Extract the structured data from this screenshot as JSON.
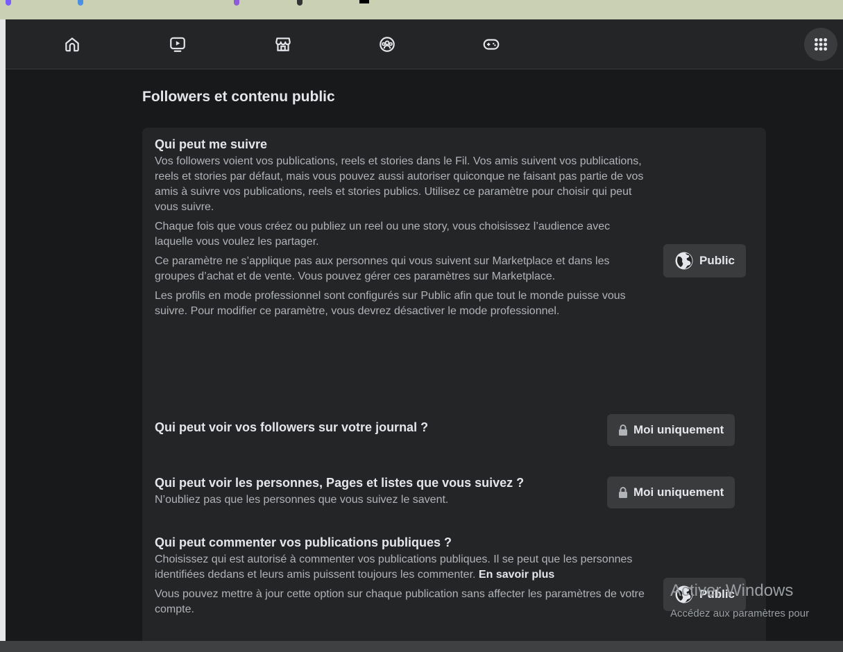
{
  "nav": {
    "tabs": [
      {
        "name": "home-icon"
      },
      {
        "name": "watch-icon"
      },
      {
        "name": "marketplace-icon"
      },
      {
        "name": "groups-icon"
      },
      {
        "name": "gaming-icon"
      }
    ],
    "menu_icon": "grid-menu-icon"
  },
  "page": {
    "title": "Followers et contenu public"
  },
  "sections": {
    "who_can_follow": {
      "title": "Qui peut me suivre",
      "p1": "Vos followers voient vos publications, reels et stories dans le Fil. Vos amis suivent vos publications, reels et stories par défaut, mais vous pouvez aussi autoriser quiconque ne faisant pas partie de vos amis à suivre vos publications, reels et stories publics. Utilisez ce paramètre pour choisir qui peut vous suivre.",
      "p2": "Chaque fois que vous créez ou publiez un reel ou une story, vous choisissez l’audience avec laquelle vous voulez les partager.",
      "p3": "Ce paramètre ne s’applique pas aux personnes qui vous suivent sur Marketplace et dans les groupes d’achat et de vente. Vous pouvez gérer ces paramètres sur Marketplace.",
      "p4": "Les profils en mode professionnel sont configurés sur Public afin que tout le monde puisse vous suivre. Pour modifier ce paramètre, vous devrez désactiver le mode professionnel.",
      "button": "Public"
    },
    "followers_visibility": {
      "title": "Qui peut voir vos followers sur votre journal ?",
      "button": "Moi uniquement"
    },
    "following_visibility": {
      "title": "Qui peut voir les personnes, Pages et listes que vous suivez ?",
      "desc": "N’oubliez pas que les personnes que vous suivez le savent.",
      "button": "Moi uniquement"
    },
    "public_comments": {
      "title": "Qui peut commenter vos publications publiques ?",
      "p1": "Choisissez qui est autorisé à commenter vos publications publiques. Il se peut que les personnes identifiées dedans et leurs amis puissent toujours les commenter.",
      "learn_more": "En savoir plus",
      "p2": "Vous pouvez mettre à jour cette option sur chaque publication sans affecter les paramètres de votre compte.",
      "button": "Public"
    }
  },
  "watermark": {
    "line1": "Activer Windows",
    "line2": "Accédez aux paramètres pour"
  },
  "colors": {
    "background": "#18191a",
    "card": "#242526",
    "button": "#3a3b3c"
  }
}
